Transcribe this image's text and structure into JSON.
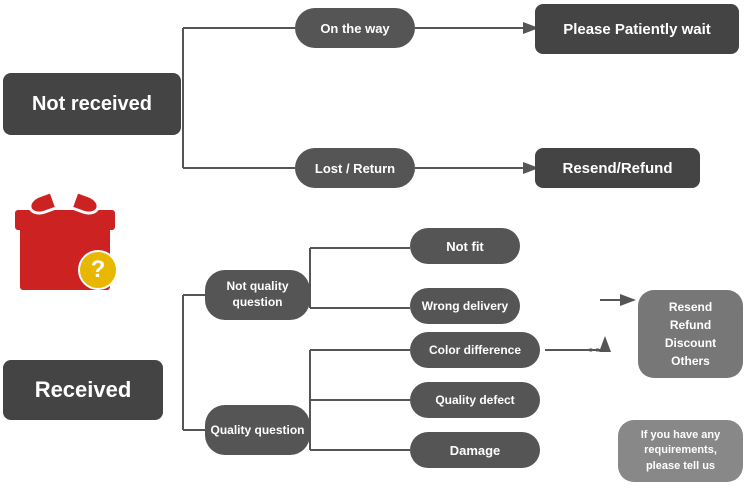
{
  "nodes": {
    "not_received": "Not received",
    "on_the_way": "On the way",
    "please_wait": "Please Patiently wait",
    "lost_return": "Lost / Return",
    "resend_refund_top": "Resend/Refund",
    "received": "Received",
    "not_quality": "Not quality question",
    "quality": "Quality question",
    "not_fit": "Not fit",
    "wrong_delivery": "Wrong delivery",
    "color_diff": "Color difference",
    "quality_defect": "Quality defect",
    "damage": "Damage",
    "resend_options": "Resend\nRefund\nDiscount\nOthers",
    "tell_us": "If you have any requirements, please tell us"
  }
}
